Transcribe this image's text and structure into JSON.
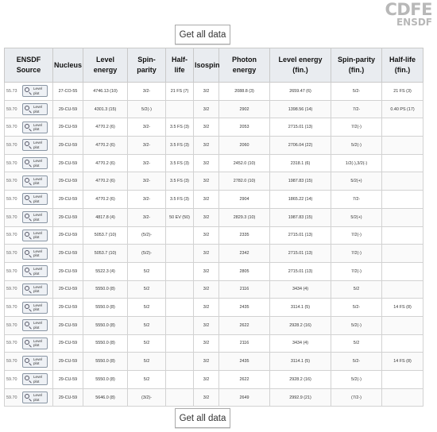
{
  "logo": {
    "line1": "CDFE",
    "line2": "ENSDF"
  },
  "buttons": {
    "get_all_top": "Get all data",
    "get_all_bottom": "Get all data"
  },
  "table": {
    "headers": [
      "ENSDF Source",
      "Nucleus",
      "Level energy",
      "Spin-parity",
      "Half-life",
      "Isospin",
      "Photon energy",
      "Level energy (fin.)",
      "Spin-parity (fin.)",
      "Half-life (fin.)"
    ],
    "level_plot_label": "Level plot",
    "rows": [
      {
        "source": "55.73",
        "nucleus": "27-CO-55",
        "level_energy": "4746.13 (10)",
        "spin_parity": "3/2-",
        "half_life": "21 FS (7)",
        "isospin": "3/2",
        "photon_energy": "2088.8 (3)",
        "level_energy_fin": "2659.47 (6)",
        "spin_parity_fin": "5/2-",
        "half_life_fin": "21 FS (3)"
      },
      {
        "source": "59.70",
        "nucleus": "29-CU-59",
        "level_energy": "4301.3 (15)",
        "spin_parity": "5/2(-)",
        "half_life": "",
        "isospin": "3/2",
        "photon_energy": "2902",
        "level_energy_fin": "1398.56 (14)",
        "spin_parity_fin": "7/2-",
        "half_life_fin": "0.40 PS (17)"
      },
      {
        "source": "59.70",
        "nucleus": "29-CU-59",
        "level_energy": "4770.2 (6)",
        "spin_parity": "3/2-",
        "half_life": "3.5 FS (3)",
        "isospin": "3/2",
        "photon_energy": "2053",
        "level_energy_fin": "2715.01 (13)",
        "spin_parity_fin": "7/2(-)",
        "half_life_fin": ""
      },
      {
        "source": "59.70",
        "nucleus": "29-CU-59",
        "level_energy": "4770.2 (6)",
        "spin_parity": "3/2-",
        "half_life": "3.5 FS (3)",
        "isospin": "3/2",
        "photon_energy": "2060",
        "level_energy_fin": "2706.04 (22)",
        "spin_parity_fin": "5/2(-)",
        "half_life_fin": ""
      },
      {
        "source": "59.70",
        "nucleus": "29-CU-59",
        "level_energy": "4770.2 (6)",
        "spin_parity": "3/2-",
        "half_life": "3.5 FS (3)",
        "isospin": "3/2",
        "photon_energy": "2452.0 (10)",
        "level_energy_fin": "2318.1 (6)",
        "spin_parity_fin": "1/2(-),3/2(-)",
        "half_life_fin": ""
      },
      {
        "source": "59.70",
        "nucleus": "29-CU-59",
        "level_energy": "4770.2 (6)",
        "spin_parity": "3/2-",
        "half_life": "3.5 FS (3)",
        "isospin": "3/2",
        "photon_energy": "2782.0 (10)",
        "level_energy_fin": "1987.83 (15)",
        "spin_parity_fin": "5/2(+)",
        "half_life_fin": ""
      },
      {
        "source": "59.70",
        "nucleus": "29-CU-59",
        "level_energy": "4770.2 (6)",
        "spin_parity": "3/2-",
        "half_life": "3.5 FS (3)",
        "isospin": "3/2",
        "photon_energy": "2904",
        "level_energy_fin": "1865.22 (14)",
        "spin_parity_fin": "7/2-",
        "half_life_fin": ""
      },
      {
        "source": "59.70",
        "nucleus": "29-CU-59",
        "level_energy": "4817.8 (4)",
        "spin_parity": "3/2-",
        "half_life": "50 EV (50)",
        "isospin": "3/2",
        "photon_energy": "2829.3 (10)",
        "level_energy_fin": "1987.83 (15)",
        "spin_parity_fin": "5/2(+)",
        "half_life_fin": ""
      },
      {
        "source": "59.70",
        "nucleus": "29-CU-59",
        "level_energy": "5053.7 (10)",
        "spin_parity": "(5/2)-",
        "half_life": "",
        "isospin": "3/2",
        "photon_energy": "2335",
        "level_energy_fin": "2715.01 (13)",
        "spin_parity_fin": "7/2(-)",
        "half_life_fin": ""
      },
      {
        "source": "59.70",
        "nucleus": "29-CU-59",
        "level_energy": "5053.7 (10)",
        "spin_parity": "(5/2)-",
        "half_life": "",
        "isospin": "3/2",
        "photon_energy": "2342",
        "level_energy_fin": "2715.01 (13)",
        "spin_parity_fin": "7/2(-)",
        "half_life_fin": ""
      },
      {
        "source": "59.70",
        "nucleus": "29-CU-59",
        "level_energy": "5522.3 (4)",
        "spin_parity": "5/2",
        "half_life": "",
        "isospin": "3/2",
        "photon_energy": "2805",
        "level_energy_fin": "2715.01 (13)",
        "spin_parity_fin": "7/2(-)",
        "half_life_fin": ""
      },
      {
        "source": "59.70",
        "nucleus": "29-CU-59",
        "level_energy": "5550.0 (8)",
        "spin_parity": "5/2",
        "half_life": "",
        "isospin": "3/2",
        "photon_energy": "2116",
        "level_energy_fin": "3434 (4)",
        "spin_parity_fin": "5/2",
        "half_life_fin": ""
      },
      {
        "source": "59.70",
        "nucleus": "29-CU-59",
        "level_energy": "5550.0 (8)",
        "spin_parity": "5/2",
        "half_life": "",
        "isospin": "3/2",
        "photon_energy": "2435",
        "level_energy_fin": "3114.1 (5)",
        "spin_parity_fin": "5/2-",
        "half_life_fin": "14 FS (8)"
      },
      {
        "source": "59.70",
        "nucleus": "29-CU-59",
        "level_energy": "5550.0 (8)",
        "spin_parity": "5/2",
        "half_life": "",
        "isospin": "3/2",
        "photon_energy": "2622",
        "level_energy_fin": "2928.2 (16)",
        "spin_parity_fin": "5/2(-)",
        "half_life_fin": ""
      },
      {
        "source": "59.70",
        "nucleus": "29-CU-59",
        "level_energy": "5550.0 (8)",
        "spin_parity": "5/2",
        "half_life": "",
        "isospin": "3/2",
        "photon_energy": "2116",
        "level_energy_fin": "3434 (4)",
        "spin_parity_fin": "5/2",
        "half_life_fin": ""
      },
      {
        "source": "59.70",
        "nucleus": "29-CU-59",
        "level_energy": "5550.0 (8)",
        "spin_parity": "5/2",
        "half_life": "",
        "isospin": "3/2",
        "photon_energy": "2435",
        "level_energy_fin": "3114.1 (5)",
        "spin_parity_fin": "5/2-",
        "half_life_fin": "14 FS (8)"
      },
      {
        "source": "59.70",
        "nucleus": "29-CU-59",
        "level_energy": "5550.0 (8)",
        "spin_parity": "5/2",
        "half_life": "",
        "isospin": "3/2",
        "photon_energy": "2622",
        "level_energy_fin": "2928.2 (16)",
        "spin_parity_fin": "5/2(-)",
        "half_life_fin": ""
      },
      {
        "source": "59.70",
        "nucleus": "29-CU-59",
        "level_energy": "5646.0 (8)",
        "spin_parity": "(3/2)-",
        "half_life": "",
        "isospin": "3/2",
        "photon_energy": "2649",
        "level_energy_fin": "2992.9 (21)",
        "spin_parity_fin": "(7/2-)",
        "half_life_fin": ""
      }
    ]
  }
}
